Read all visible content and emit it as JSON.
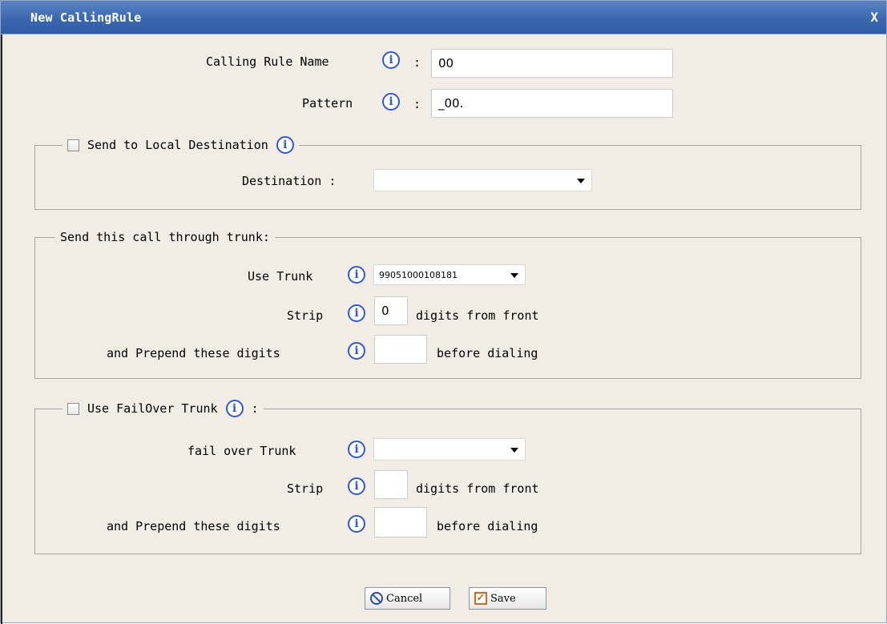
{
  "dialog": {
    "title": "New CallingRule",
    "close_label": "X"
  },
  "rule": {
    "name_label": "Calling Rule Name",
    "name_value": "00",
    "pattern_label": "Pattern",
    "pattern_value": "_00.",
    "colon": ":"
  },
  "local_destination": {
    "legend": "Send to Local Destination",
    "checked": false,
    "destination_label": "Destination :",
    "destination_value": ""
  },
  "trunk": {
    "legend": "Send this call through trunk:",
    "use_trunk_label": "Use Trunk",
    "use_trunk_value": "99051000108181",
    "strip_label": "Strip",
    "strip_value": "0",
    "strip_suffix": "digits from front",
    "prepend_label": "and Prepend these digits",
    "prepend_value": "",
    "prepend_suffix": "before dialing"
  },
  "failover": {
    "legend": "Use FailOver Trunk",
    "legend_colon": ":",
    "checked": false,
    "trunk_label": "fail over Trunk",
    "trunk_value": "",
    "strip_label": "Strip",
    "strip_value": "",
    "strip_suffix": "digits from front",
    "prepend_label": "and Prepend these digits",
    "prepend_value": "",
    "prepend_suffix": "before dialing"
  },
  "buttons": {
    "cancel_label": "Cancel",
    "save_label": "Save",
    "save_icon_glyph": "✓"
  },
  "icons": {
    "info_glyph": "i"
  },
  "colors": {
    "titlebar": "#3a68b0",
    "dialog_bg": "#f1ede4",
    "info_blue": "#2f58d8"
  }
}
